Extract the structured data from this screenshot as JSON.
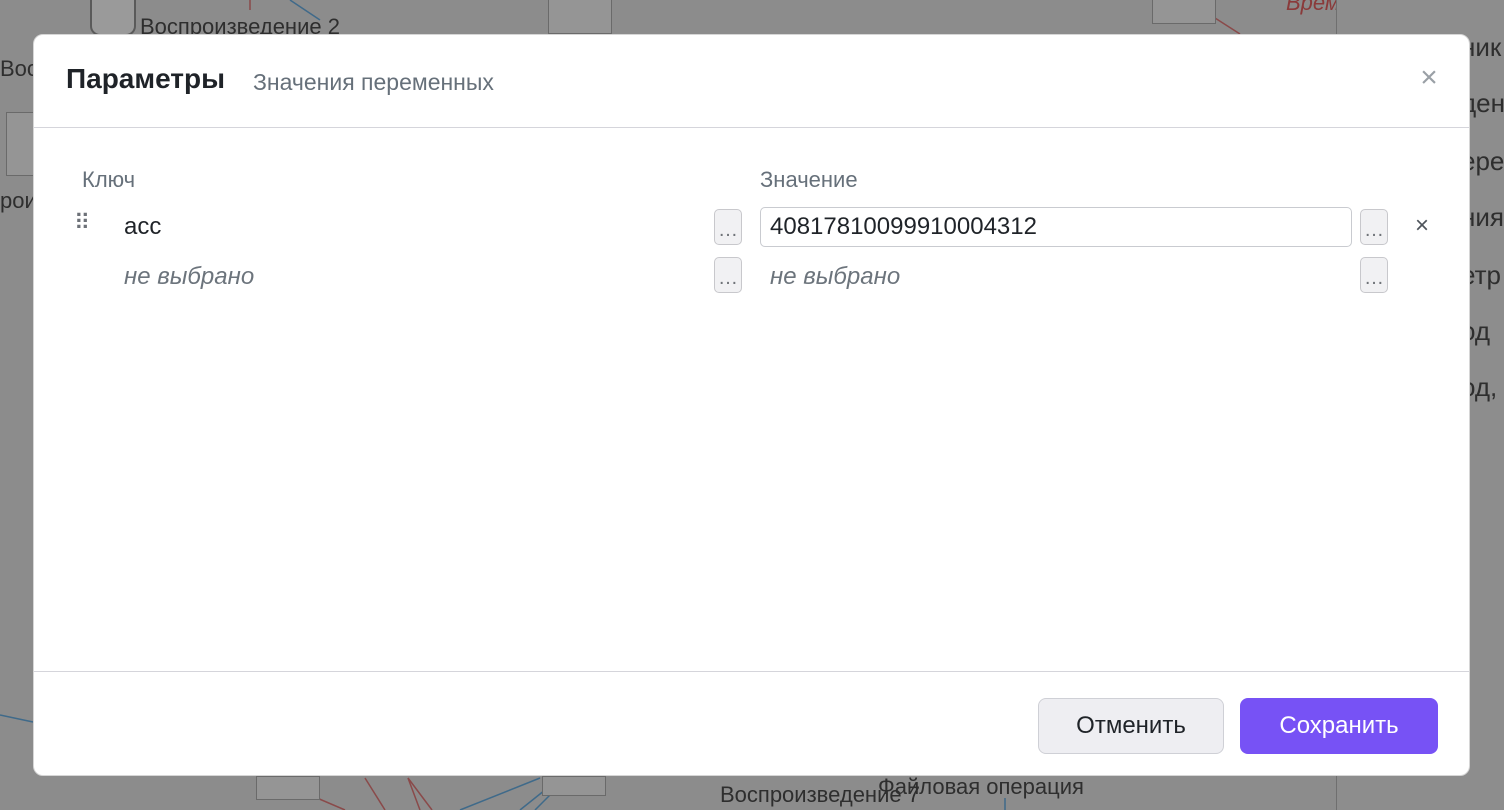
{
  "canvas": {
    "labels": [
      "Воспроизведение 2",
      "Вос",
      "роиз",
      "Воспроизведение 7",
      "Файловая операция",
      "Врем"
    ],
    "right_panel": [
      "ник",
      "ден",
      "ере",
      "ния",
      "етр",
      "од",
      "од,"
    ]
  },
  "modal": {
    "title": "Параметры",
    "subtitle": "Значения переменных",
    "close_icon": "close-icon",
    "columns": {
      "key": "Ключ",
      "value": "Значение"
    },
    "rows": [
      {
        "key": "acc",
        "value": "40817810099910004312",
        "key_btn": "…",
        "value_btn": "…",
        "remove": "×"
      },
      {
        "key_placeholder": "не выбрано",
        "value_placeholder": "не выбрано",
        "key_btn": "…",
        "value_btn": "…"
      }
    ],
    "footer": {
      "cancel": "Отменить",
      "save": "Сохранить"
    },
    "accent_color": "#7752f5"
  }
}
